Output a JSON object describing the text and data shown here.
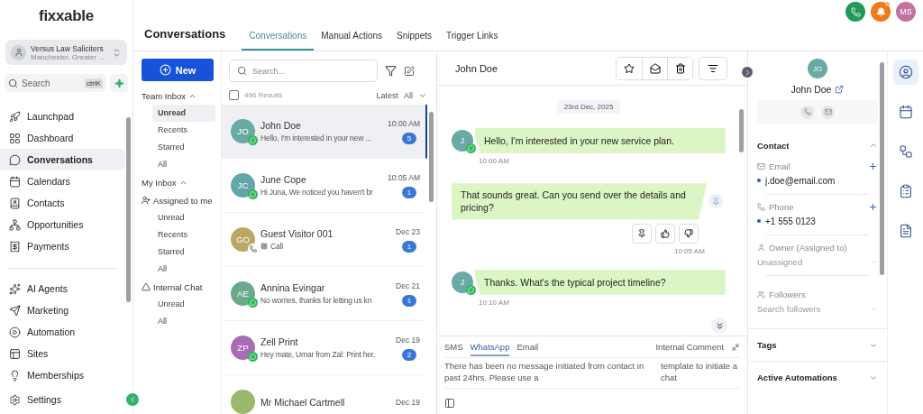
{
  "sidebar": {
    "logo": "fixxable",
    "account": {
      "name": "Versus Law Saliciters",
      "location": "Manchester, Greater ..."
    },
    "search": {
      "placeholder": "Search",
      "shortcut": "ctrlK"
    },
    "nav_main": [
      {
        "label": "Launchpad",
        "selected": false
      },
      {
        "label": "Dashboard",
        "selected": false
      },
      {
        "label": "Conversations",
        "selected": true
      },
      {
        "label": "Calendars",
        "selected": false
      },
      {
        "label": "Contacts",
        "selected": false
      },
      {
        "label": "Opportunities",
        "selected": false
      },
      {
        "label": "Payments",
        "selected": false
      }
    ],
    "nav_more": [
      {
        "label": "AI Agents",
        "selected": false
      },
      {
        "label": "Marketing",
        "selected": false
      },
      {
        "label": "Automation",
        "selected": false
      },
      {
        "label": "Sites",
        "selected": false
      },
      {
        "label": "Memberships",
        "selected": false
      }
    ],
    "settings": "Settings"
  },
  "header": {
    "title": "Conversations",
    "tabs": [
      {
        "label": "Conversations",
        "selected": true
      },
      {
        "label": "Manual Actions",
        "selected": false
      },
      {
        "label": "Snippets",
        "selected": false
      },
      {
        "label": "Trigger Links",
        "selected": false
      }
    ],
    "user_initials": "MS"
  },
  "inbox": {
    "new_button": "New",
    "items": [
      {
        "kind": "header",
        "label": "Team Inbox",
        "expanded": true
      },
      {
        "kind": "item",
        "label": "Unread",
        "selected": true
      },
      {
        "kind": "item",
        "label": "Recents",
        "selected": false
      },
      {
        "kind": "item",
        "label": "Starred",
        "selected": false
      },
      {
        "kind": "item",
        "label": "All",
        "selected": false
      },
      {
        "kind": "header",
        "label": "My Inbox",
        "expanded": true
      },
      {
        "kind": "person",
        "label": "Assigned to me"
      },
      {
        "kind": "item",
        "label": "Unread",
        "selected": false
      },
      {
        "kind": "item",
        "label": "Recents",
        "selected": false
      },
      {
        "kind": "item",
        "label": "Starred",
        "selected": false
      },
      {
        "kind": "item",
        "label": "All",
        "selected": false
      },
      {
        "kind": "chat",
        "label": "Internal Chat"
      },
      {
        "kind": "item",
        "label": "Unread",
        "selected": false
      },
      {
        "kind": "item",
        "label": "All",
        "selected": false
      }
    ]
  },
  "conversations": {
    "search_placeholder": "Search...",
    "select_all_checked": false,
    "results": "496 Results",
    "sort": "Latest",
    "filter": "All",
    "rows": [
      {
        "initials": "JO",
        "color": "#6aa9a5",
        "kind": "whatsapp",
        "name": "John Doe",
        "preview": "Hello, I'm interested in your new ...",
        "time": "10:00 AM",
        "unread": "5",
        "selected": true
      },
      {
        "initials": "JC",
        "color": "#62a6a9",
        "kind": "whatsapp",
        "name": "June Cope",
        "preview": "Hi Juna, We noticed you haven't br",
        "time": "10:05 AM",
        "unread": "1",
        "selected": false
      },
      {
        "initials": "GO",
        "color": "#b9a965",
        "kind": "call",
        "name": "Guest Visitor 001",
        "preview": "Call",
        "time": "Dec 23",
        "unread": "1",
        "selected": false
      },
      {
        "initials": "AE",
        "color": "#6ba88d",
        "kind": "whatsapp",
        "name": "Annina Evingar",
        "preview": "No worries, thanks for letting us kn",
        "time": "Dec 21",
        "unread": "1",
        "selected": false
      },
      {
        "initials": "ZP",
        "color": "#a86cb6",
        "kind": "whatsapp",
        "name": "Zell Print",
        "preview": "Hey mate, Umar from Zal: Print her.",
        "time": "Dec 19",
        "unread": "2",
        "selected": false
      },
      {
        "color": "#9bb86c",
        "kind": "plain",
        "name": "Mr Michael Cartmell",
        "time": "Dec 19",
        "selected": false
      }
    ]
  },
  "chat": {
    "contact_name": "John Doe",
    "date": "23rd Dec, 2025",
    "messages": [
      {
        "kind": "in",
        "avatar": "J",
        "text": "Hello, I'm interested in your new service plan.",
        "time": "10:00 AM",
        "show_actions": false
      },
      {
        "kind": "out",
        "text": "That sounds great. Can you send over the details and pricing?",
        "time": "10:05 AM",
        "show_actions": true
      },
      {
        "kind": "in",
        "avatar": "J",
        "text": "Thanks. What's the typical project timeline?",
        "time": "10:10 AM",
        "show_actions": false
      }
    ],
    "composer": {
      "tabs": [
        {
          "label": "SMS",
          "selected": false
        },
        {
          "label": "WhatsApp",
          "selected": true
        },
        {
          "label": "Email",
          "selected": false
        }
      ],
      "internal_comment": "Internal Comment",
      "notice": "There has been no message initiated from contact in past 24hrs. Please use a",
      "notice_side": "template to initiate a chat"
    }
  },
  "contact": {
    "initials": "JO",
    "name": "John Doe",
    "section_title": "Contact",
    "expanded": true,
    "email_label": "Email",
    "email": "j.doe@email.com",
    "phone_label": "Phone",
    "phone": "+1 555 0123",
    "owner_label": "Owner (Assigned to)",
    "owner": "Unassigned",
    "followers_label": "Followers",
    "followers_placeholder": "Search followers",
    "collapsed_sections": [
      {
        "label": "Tags",
        "expanded": false
      },
      {
        "label": "Active Automations",
        "expanded": false
      }
    ]
  },
  "rail": [
    {
      "selected": true
    },
    {
      "selected": false
    },
    {
      "selected": false
    },
    {
      "selected": false
    },
    {
      "selected": false
    }
  ]
}
